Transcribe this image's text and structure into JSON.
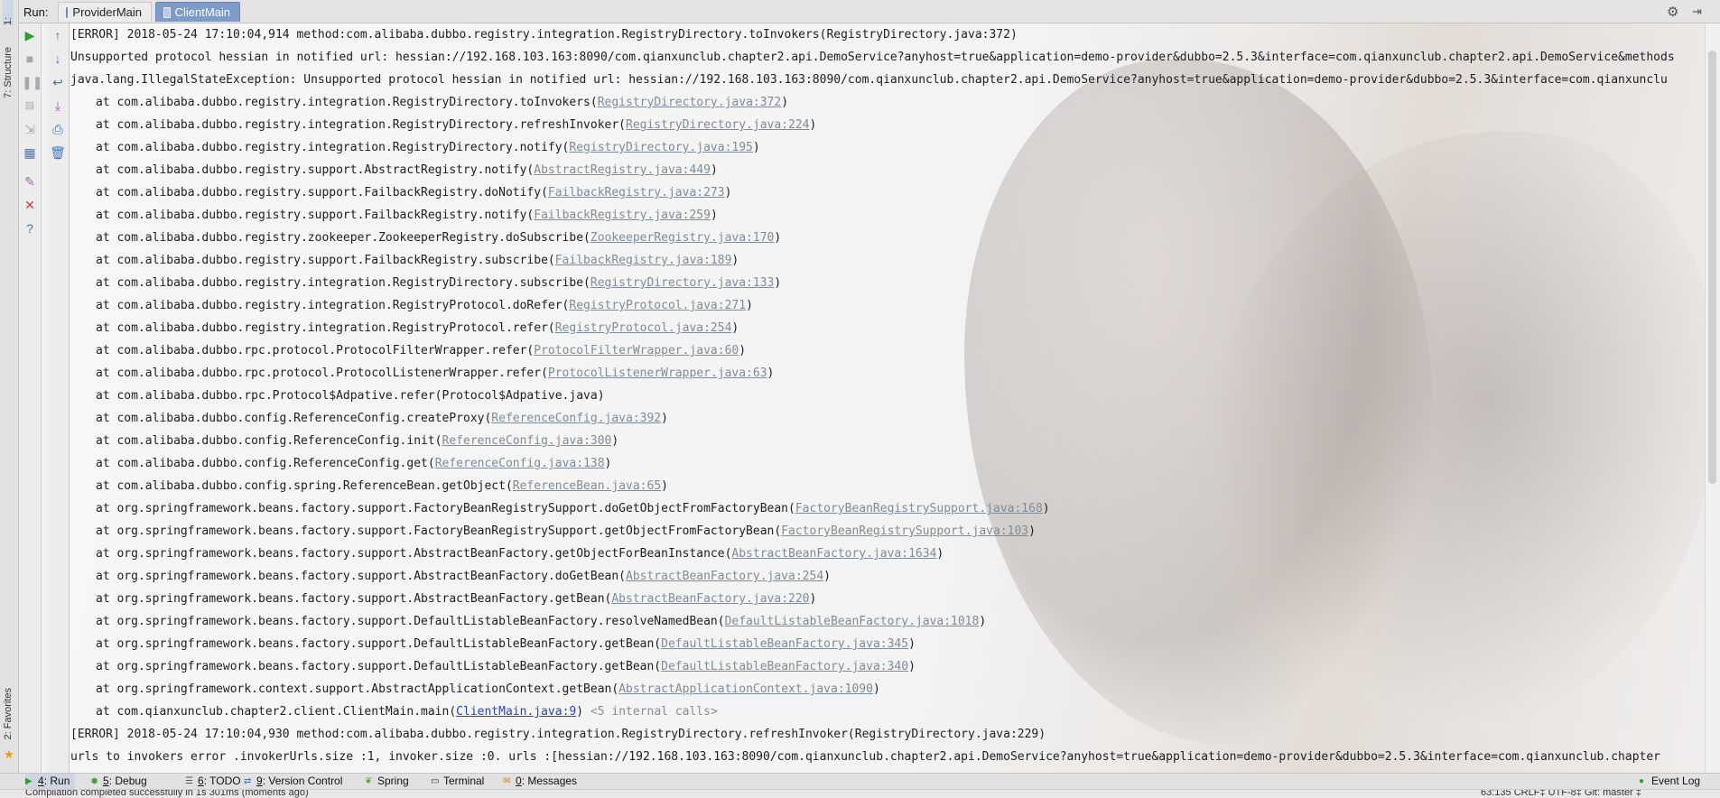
{
  "run_bar": {
    "label": "Run:",
    "tabs": [
      {
        "label": "ProviderMain",
        "active": false
      },
      {
        "label": "ClientMain",
        "active": true
      }
    ]
  },
  "left_stripe": {
    "top_tab": "1:",
    "structure": "7: Structure",
    "favorites": "2: Favorites"
  },
  "toolbar": {
    "col1": [
      "run-icon",
      "stop-icon",
      "pause-icon",
      "dump-threads-icon",
      "exit-icon",
      "layout-icon",
      "pin-icon",
      "close-icon",
      "help-icon"
    ],
    "col2": [
      "up-arrow-icon",
      "down-arrow-icon",
      "soft-wrap-icon",
      "scroll-to-end-icon",
      "print-icon",
      "clear-icon"
    ]
  },
  "console": {
    "error_header_1": "[ERROR] 2018-05-24 17:10:04,914 method:com.alibaba.dubbo.registry.integration.RegistryDirectory.toInvokers(RegistryDirectory.java:372)",
    "message_1": "Unsupported protocol hessian in notified url: hessian://192.168.103.163:8090/com.qianxunclub.chapter2.api.DemoService?anyhost=true&application=demo-provider&dubbo=2.5.3&interface=com.qianxunclub.chapter2.api.DemoService&methods",
    "exception": "java.lang.IllegalStateException: Unsupported protocol hessian in notified url: hessian://192.168.103.163:8090/com.qianxunclub.chapter2.api.DemoService?anyhost=true&application=demo-provider&dubbo=2.5.3&interface=com.qianxunclu",
    "stack": [
      {
        "at": "at com.alibaba.dubbo.registry.integration.RegistryDirectory.toInvokers(",
        "link": "RegistryDirectory.java:372",
        "tail": ")"
      },
      {
        "at": "at com.alibaba.dubbo.registry.integration.RegistryDirectory.refreshInvoker(",
        "link": "RegistryDirectory.java:224",
        "tail": ")"
      },
      {
        "at": "at com.alibaba.dubbo.registry.integration.RegistryDirectory.notify(",
        "link": "RegistryDirectory.java:195",
        "tail": ")"
      },
      {
        "at": "at com.alibaba.dubbo.registry.support.AbstractRegistry.notify(",
        "link": "AbstractRegistry.java:449",
        "tail": ")"
      },
      {
        "at": "at com.alibaba.dubbo.registry.support.FailbackRegistry.doNotify(",
        "link": "FailbackRegistry.java:273",
        "tail": ")"
      },
      {
        "at": "at com.alibaba.dubbo.registry.support.FailbackRegistry.notify(",
        "link": "FailbackRegistry.java:259",
        "tail": ")"
      },
      {
        "at": "at com.alibaba.dubbo.registry.zookeeper.ZookeeperRegistry.doSubscribe(",
        "link": "ZookeeperRegistry.java:170",
        "tail": ")"
      },
      {
        "at": "at com.alibaba.dubbo.registry.support.FailbackRegistry.subscribe(",
        "link": "FailbackRegistry.java:189",
        "tail": ")"
      },
      {
        "at": "at com.alibaba.dubbo.registry.integration.RegistryDirectory.subscribe(",
        "link": "RegistryDirectory.java:133",
        "tail": ")"
      },
      {
        "at": "at com.alibaba.dubbo.registry.integration.RegistryProtocol.doRefer(",
        "link": "RegistryProtocol.java:271",
        "tail": ")"
      },
      {
        "at": "at com.alibaba.dubbo.registry.integration.RegistryProtocol.refer(",
        "link": "RegistryProtocol.java:254",
        "tail": ")"
      },
      {
        "at": "at com.alibaba.dubbo.rpc.protocol.ProtocolFilterWrapper.refer(",
        "link": "ProtocolFilterWrapper.java:60",
        "tail": ")"
      },
      {
        "at": "at com.alibaba.dubbo.rpc.protocol.ProtocolListenerWrapper.refer(",
        "link": "ProtocolListenerWrapper.java:63",
        "tail": ")"
      },
      {
        "at": "at com.alibaba.dubbo.rpc.Protocol$Adpative.refer(Protocol$Adpative.java)",
        "link": "",
        "tail": ""
      },
      {
        "at": "at com.alibaba.dubbo.config.ReferenceConfig.createProxy(",
        "link": "ReferenceConfig.java:392",
        "tail": ")"
      },
      {
        "at": "at com.alibaba.dubbo.config.ReferenceConfig.init(",
        "link": "ReferenceConfig.java:300",
        "tail": ")"
      },
      {
        "at": "at com.alibaba.dubbo.config.ReferenceConfig.get(",
        "link": "ReferenceConfig.java:138",
        "tail": ")"
      },
      {
        "at": "at com.alibaba.dubbo.config.spring.ReferenceBean.getObject(",
        "link": "ReferenceBean.java:65",
        "tail": ")"
      },
      {
        "at": "at org.springframework.beans.factory.support.FactoryBeanRegistrySupport.doGetObjectFromFactoryBean(",
        "link": "FactoryBeanRegistrySupport.java:168",
        "tail": ")"
      },
      {
        "at": "at org.springframework.beans.factory.support.FactoryBeanRegistrySupport.getObjectFromFactoryBean(",
        "link": "FactoryBeanRegistrySupport.java:103",
        "tail": ")"
      },
      {
        "at": "at org.springframework.beans.factory.support.AbstractBeanFactory.getObjectForBeanInstance(",
        "link": "AbstractBeanFactory.java:1634",
        "tail": ")"
      },
      {
        "at": "at org.springframework.beans.factory.support.AbstractBeanFactory.doGetBean(",
        "link": "AbstractBeanFactory.java:254",
        "tail": ")"
      },
      {
        "at": "at org.springframework.beans.factory.support.AbstractBeanFactory.getBean(",
        "link": "AbstractBeanFactory.java:220",
        "tail": ")"
      },
      {
        "at": "at org.springframework.beans.factory.support.DefaultListableBeanFactory.resolveNamedBean(",
        "link": "DefaultListableBeanFactory.java:1018",
        "tail": ")"
      },
      {
        "at": "at org.springframework.beans.factory.support.DefaultListableBeanFactory.getBean(",
        "link": "DefaultListableBeanFactory.java:345",
        "tail": ")"
      },
      {
        "at": "at org.springframework.beans.factory.support.DefaultListableBeanFactory.getBean(",
        "link": "DefaultListableBeanFactory.java:340",
        "tail": ")"
      },
      {
        "at": "at org.springframework.context.support.AbstractApplicationContext.getBean(",
        "link": "AbstractApplicationContext.java:1090",
        "tail": ")"
      }
    ],
    "last_frame": {
      "at": "at com.qianxunclub.chapter2.client.ClientMain.main(",
      "link": "ClientMain.java:9",
      "tail": ")",
      "internal": " <5 internal calls>"
    },
    "error_header_2": "[ERROR] 2018-05-24 17:10:04,930 method:com.alibaba.dubbo.registry.integration.RegistryDirectory.refreshInvoker(RegistryDirectory.java:229)",
    "message_2": "urls to invokers error .invokerUrls.size :1, invoker.size :0. urls :[hessian://192.168.103.163:8090/com.qianxunclub.chapter2.api.DemoService?anyhost=true&application=demo-provider&dubbo=2.5.3&interface=com.qianxunclub.chapter"
  },
  "bottom_tools": [
    {
      "num": "4",
      "label": ": Run",
      "icon": "run-icon",
      "active": true
    },
    {
      "num": "5",
      "label": ": Debug",
      "icon": "debug-icon",
      "active": false
    },
    {
      "num": "6",
      "label": ": TODO",
      "icon": "todo-icon",
      "active": false
    },
    {
      "num": "9",
      "label": ": Version Control",
      "icon": "vcs-icon",
      "active": false
    },
    {
      "num": "",
      "label": "Spring",
      "icon": "spring-icon",
      "active": false
    },
    {
      "num": "",
      "label": "Terminal",
      "icon": "terminal-icon",
      "active": false
    },
    {
      "num": "0",
      "label": ": Messages",
      "icon": "messages-icon",
      "active": false
    }
  ],
  "event_log": "Event Log",
  "status": {
    "left": "Compilation completed successfully in 1s 301ms (moments ago)",
    "right": "63:135   CRLF‡   UTF-8‡   Git: master ‡"
  },
  "colors": {
    "active_tab": "#7c9bc6",
    "link": "#7f8c99",
    "source_link": "#2545c8",
    "run_green": "#2f9d2f",
    "stop_red": "#d23c3c"
  }
}
